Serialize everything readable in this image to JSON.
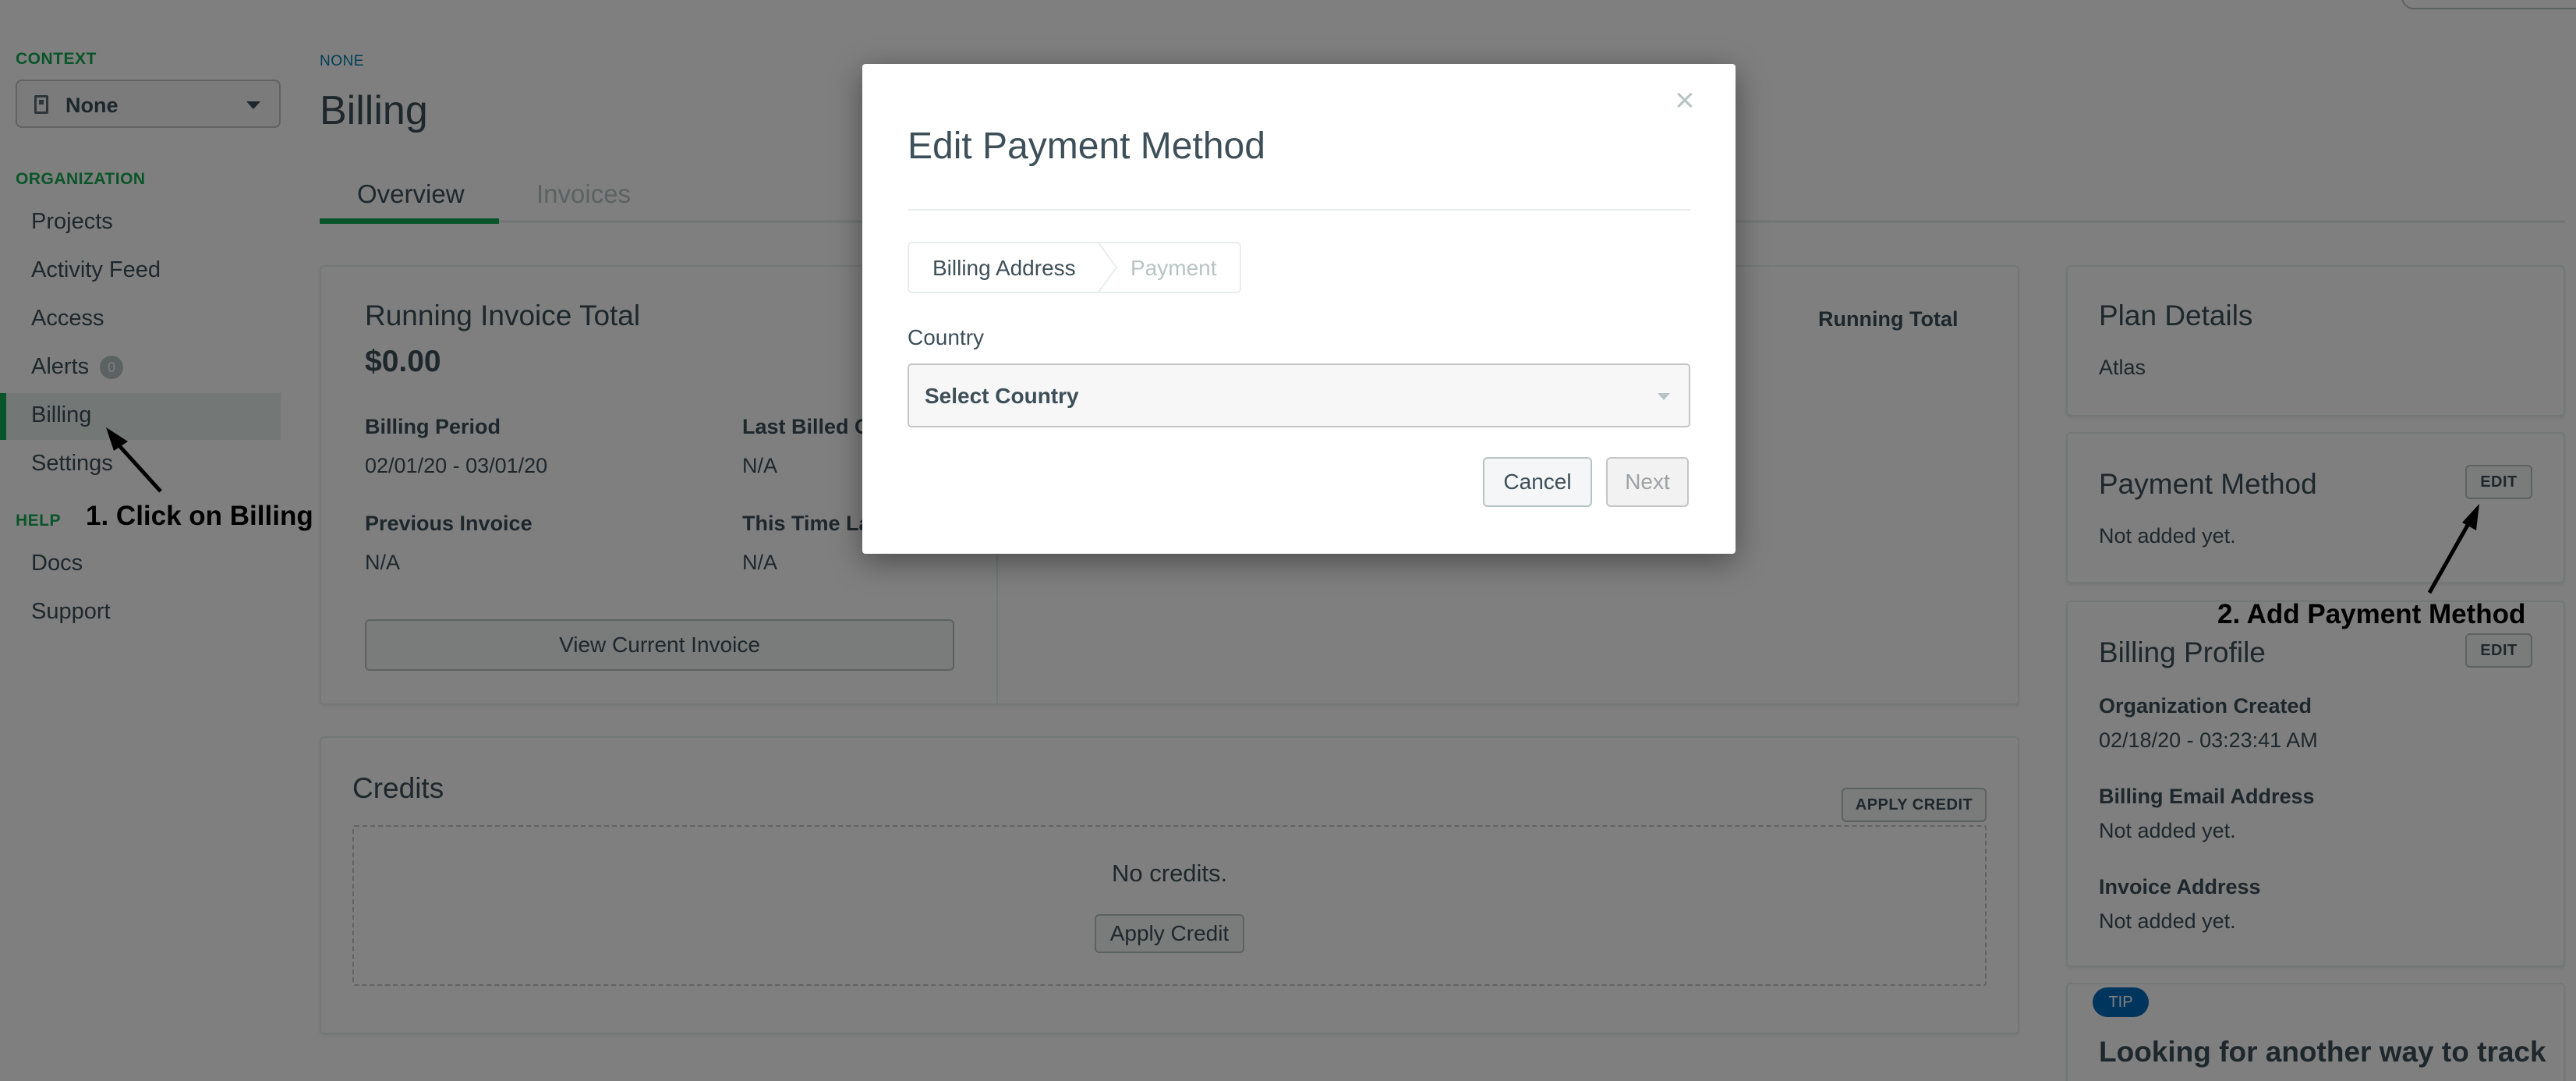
{
  "sidebar": {
    "context_heading": "CONTEXT",
    "context_value": "None",
    "org_heading": "ORGANIZATION",
    "org_items": [
      {
        "label": "Projects"
      },
      {
        "label": "Activity Feed"
      },
      {
        "label": "Access"
      },
      {
        "label": "Alerts",
        "badge": "0"
      },
      {
        "label": "Billing",
        "active": true
      },
      {
        "label": "Settings"
      }
    ],
    "help_heading": "HELP",
    "help_items": [
      {
        "label": "Docs"
      },
      {
        "label": "Support"
      }
    ]
  },
  "header": {
    "breadcrumb": "NONE",
    "title": "Billing",
    "tabs": [
      {
        "label": "Overview",
        "active": true
      },
      {
        "label": "Invoices",
        "active": false
      }
    ]
  },
  "invoice_panel": {
    "title": "Running Invoice Total",
    "amount": "$0.00",
    "billing_period_label": "Billing Period",
    "billing_period_value": "02/01/20 - 03/01/20",
    "last_billed_label": "Last Billed C",
    "last_billed_value": "N/A",
    "previous_invoice_label": "Previous Invoice",
    "previous_invoice_value": "N/A",
    "this_time_label": "This Time La",
    "this_time_value": "N/A",
    "view_button": "View Current Invoice",
    "running_total_label": "Running Total"
  },
  "credits_panel": {
    "title": "Credits",
    "apply_credit_top": "APPLY CREDIT",
    "empty_text": "No credits.",
    "apply_credit_button": "Apply Credit"
  },
  "plan_panel": {
    "title": "Plan Details",
    "value": "Atlas"
  },
  "payment_panel": {
    "title": "Payment Method",
    "edit_label": "EDIT",
    "value": "Not added yet."
  },
  "profile_panel": {
    "title": "Billing Profile",
    "edit_label": "EDIT",
    "org_created_label": "Organization Created",
    "org_created_value": "02/18/20 - 03:23:41 AM",
    "email_label": "Billing Email Address",
    "email_value": "Not added yet.",
    "invoice_address_label": "Invoice Address",
    "invoice_address_value": "Not added yet."
  },
  "tip_panel": {
    "badge": "TIP",
    "title": "Looking for another way to track"
  },
  "modal": {
    "title": "Edit Payment Method",
    "close_glyph": "×",
    "steps": [
      "Billing Address",
      "Payment"
    ],
    "country_label": "Country",
    "country_value": "Select Country",
    "cancel_label": "Cancel",
    "next_label": "Next"
  },
  "annotations": {
    "step1": "1. Click on Billing",
    "step2": "2. Add Payment Method"
  },
  "colors": {
    "accent_green": "#13aa52",
    "link_blue": "#007cad",
    "text": "#3d4f58",
    "tip_badge": "#006cbc"
  }
}
